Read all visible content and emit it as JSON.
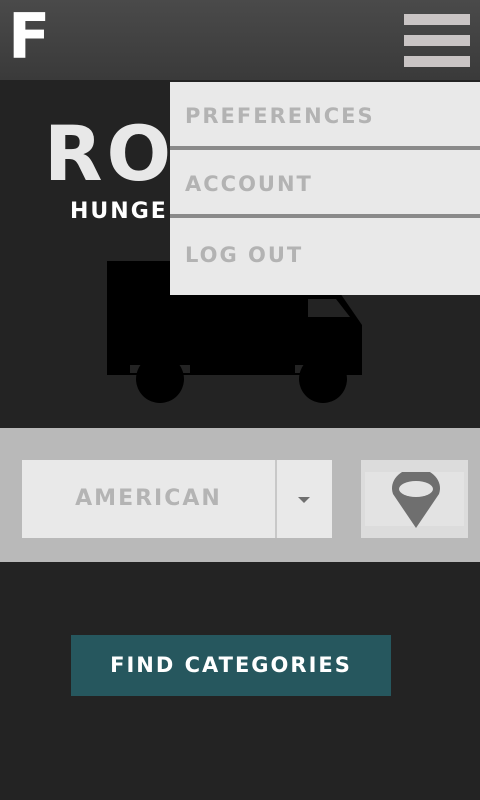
{
  "app": {
    "logo": "F"
  },
  "hero": {
    "title": "RO",
    "subtitle": "HUNGE",
    "truck_icon": "truck-icon"
  },
  "search": {
    "category_value": "AMERICAN",
    "location_icon": "map-pin-icon"
  },
  "actions": {
    "find_label": "FIND CATEGORIES"
  },
  "menu": {
    "icon": "hamburger-menu-icon",
    "items": [
      {
        "label": "PREFERENCES"
      },
      {
        "label": "ACCOUNT"
      },
      {
        "label": "LOG OUT"
      }
    ]
  },
  "colors": {
    "topbar": "#404040",
    "background": "#232323",
    "band": "#b9b9b9",
    "button": "#26575e",
    "menu_bg": "#e9e9e9",
    "menu_text": "#b3b3b3"
  }
}
